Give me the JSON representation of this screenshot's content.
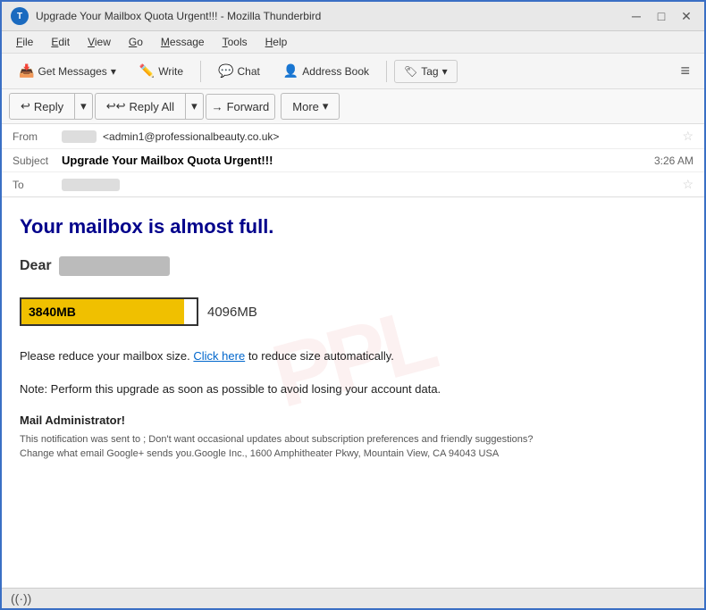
{
  "titlebar": {
    "title": "Upgrade Your Mailbox Quota Urgent!!! - Mozilla Thunderbird",
    "logo_text": "T",
    "minimize_label": "─",
    "maximize_label": "□",
    "close_label": "✕"
  },
  "menubar": {
    "items": [
      {
        "label": "File",
        "underline": "F"
      },
      {
        "label": "Edit",
        "underline": "E"
      },
      {
        "label": "View",
        "underline": "V"
      },
      {
        "label": "Go",
        "underline": "G"
      },
      {
        "label": "Message",
        "underline": "M"
      },
      {
        "label": "Tools",
        "underline": "T"
      },
      {
        "label": "Help",
        "underline": "H"
      }
    ]
  },
  "toolbar": {
    "get_messages_label": "Get Messages",
    "write_label": "Write",
    "chat_label": "Chat",
    "address_book_label": "Address Book",
    "tag_label": "Tag",
    "menu_icon": "≡"
  },
  "action_toolbar": {
    "reply_label": "Reply",
    "reply_all_label": "Reply All",
    "forward_label": "Forward",
    "more_label": "More"
  },
  "email_header": {
    "from_label": "From",
    "from_sender_placeholder": "████████",
    "from_address": "<admin1@professionalbeauty.co.uk>",
    "subject_label": "Subject",
    "subject_text": "Upgrade Your Mailbox Quota Urgent!!!",
    "time": "3:26 AM",
    "to_label": "To",
    "to_placeholder": "████████████████"
  },
  "email_body": {
    "watermark": "PPL",
    "main_heading": "Your mailbox is almost full.",
    "dear_text": "Dear",
    "dear_name_placeholder": "██████████",
    "quota_used": "3840MB",
    "quota_total": "4096MB",
    "quota_percent": 93,
    "para1_prefix": "Please reduce your mailbox size.",
    "para1_link": "Click here",
    "para1_suffix": "to reduce size automatically.",
    "note_text": "Note: Perform this upgrade as soon as possible to avoid  losing your account data.",
    "admin_label": "Mail Administrator!",
    "footer_line1": "This notification was sent to ; Don't want occasional updates about subscription preferences and friendly suggestions?",
    "footer_line2": "Change what email Google+ sends you.Google Inc., 1600 Amphitheater Pkwy, Mountain View, CA 94043 USA"
  },
  "statusbar": {
    "signal_icon": "((·))"
  }
}
